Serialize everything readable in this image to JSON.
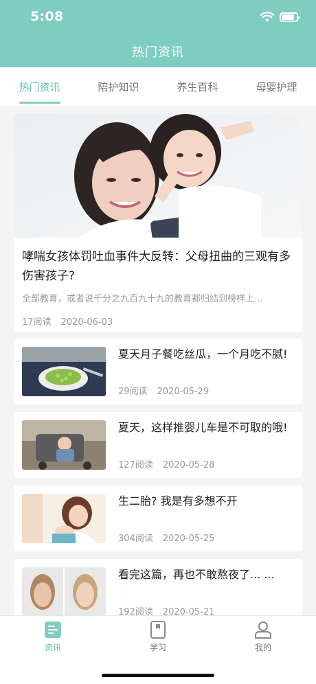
{
  "status_bar": {
    "time": "5:08"
  },
  "header": {
    "title": "热门资讯"
  },
  "tabs": [
    {
      "label": "热门资讯",
      "active": true
    },
    {
      "label": "陪护知识",
      "active": false
    },
    {
      "label": "养生百科",
      "active": false
    },
    {
      "label": "母婴护理",
      "active": false
    }
  ],
  "featured": {
    "title": "哮喘女孩体罚吐血事件大反转：父母扭曲的三观有多伤害孩子?",
    "description": "全部教育，或者说千分之九百九十九的教育都归结到榜样上…",
    "reads": "17阅读",
    "date": "2020-06-03"
  },
  "articles": [
    {
      "title": "夏天月子餐吃丝瓜，一个月吃不腻!",
      "reads": "29阅读",
      "date": "2020-05-29"
    },
    {
      "title": "夏天，这样推婴儿车是不可取的哦!",
      "reads": "127阅读",
      "date": "2020-05-28"
    },
    {
      "title": "生二胎? 我是有多想不开",
      "reads": "304阅读",
      "date": "2020-05-25"
    },
    {
      "title": "看完这篇，再也不敢熬夜了... ...",
      "reads": "192阅读",
      "date": "2020-05-21"
    }
  ],
  "tabbar": [
    {
      "label": "资讯",
      "icon": "news-icon",
      "active": true
    },
    {
      "label": "学习",
      "icon": "book-icon",
      "active": false
    },
    {
      "label": "我的",
      "icon": "user-icon",
      "active": false
    }
  ],
  "colors": {
    "accent": "#7ecdc0",
    "accent_text": "#5fbfb0"
  }
}
